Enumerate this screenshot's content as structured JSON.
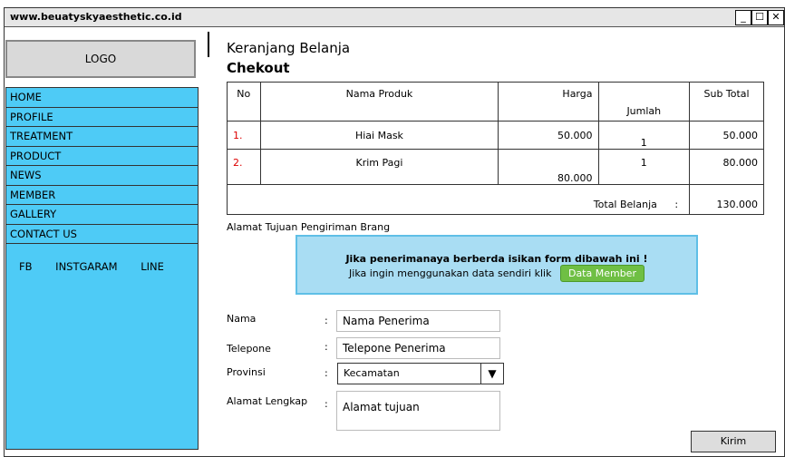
{
  "window": {
    "url": "www.beuatyskyaesthetic.co.id",
    "min_label": "_",
    "max_label": "☐",
    "close_label": "✕"
  },
  "logo": {
    "label": "LOGO"
  },
  "nav": {
    "items": [
      {
        "label": "HOME"
      },
      {
        "label": "PROFILE"
      },
      {
        "label": "TREATMENT"
      },
      {
        "label": "PRODUCT"
      },
      {
        "label": "NEWS"
      },
      {
        "label": "MEMBER"
      },
      {
        "label": "GALLERY"
      },
      {
        "label": "CONTACT US"
      }
    ],
    "social": {
      "fb": "FB",
      "ig": "INSTGARAM",
      "line": "LINE"
    }
  },
  "main": {
    "title": "Keranjang Belanja",
    "subtitle": "Chekout"
  },
  "table": {
    "headers": {
      "no": "No",
      "product": "Nama Produk",
      "price": "Harga",
      "qty": "Jumlah",
      "subtotal": "Sub Total"
    },
    "rows": [
      {
        "no": "1.",
        "product": "Hiai Mask",
        "price": "50.000",
        "qty": "1",
        "subtotal": "50.000"
      },
      {
        "no": "2.",
        "product": "Krim Pagi",
        "price": "80.000",
        "qty": "1",
        "subtotal": "80.000"
      }
    ],
    "total_label": "Total Belanja",
    "total_colon": ":",
    "total_value": "130.000"
  },
  "address": {
    "section_label": "Alamat Tujuan Pengiriman Brang",
    "notice_line1": "Jika penerimanaya berberda isikan form dibawah ini !",
    "notice_line2": "Jika ingin menggunakan data sendiri klik",
    "member_button": "Data Member"
  },
  "form": {
    "name_label": "Nama",
    "name_value": "Nama Penerima",
    "phone_label": "Telepone",
    "phone_value": "Telepone Penerima",
    "province_label": "Provinsi",
    "province_value": "Kecamatan",
    "address_label": "Alamat Lengkap",
    "address_value": "Alamat tujuan",
    "colon": ":",
    "submit_label": "Kirim"
  },
  "colors": {
    "nav_bg": "#4ecbf6",
    "notice_bg": "#a9ddf3",
    "member_btn": "#6fbf44",
    "row_number": "#dd0000"
  }
}
